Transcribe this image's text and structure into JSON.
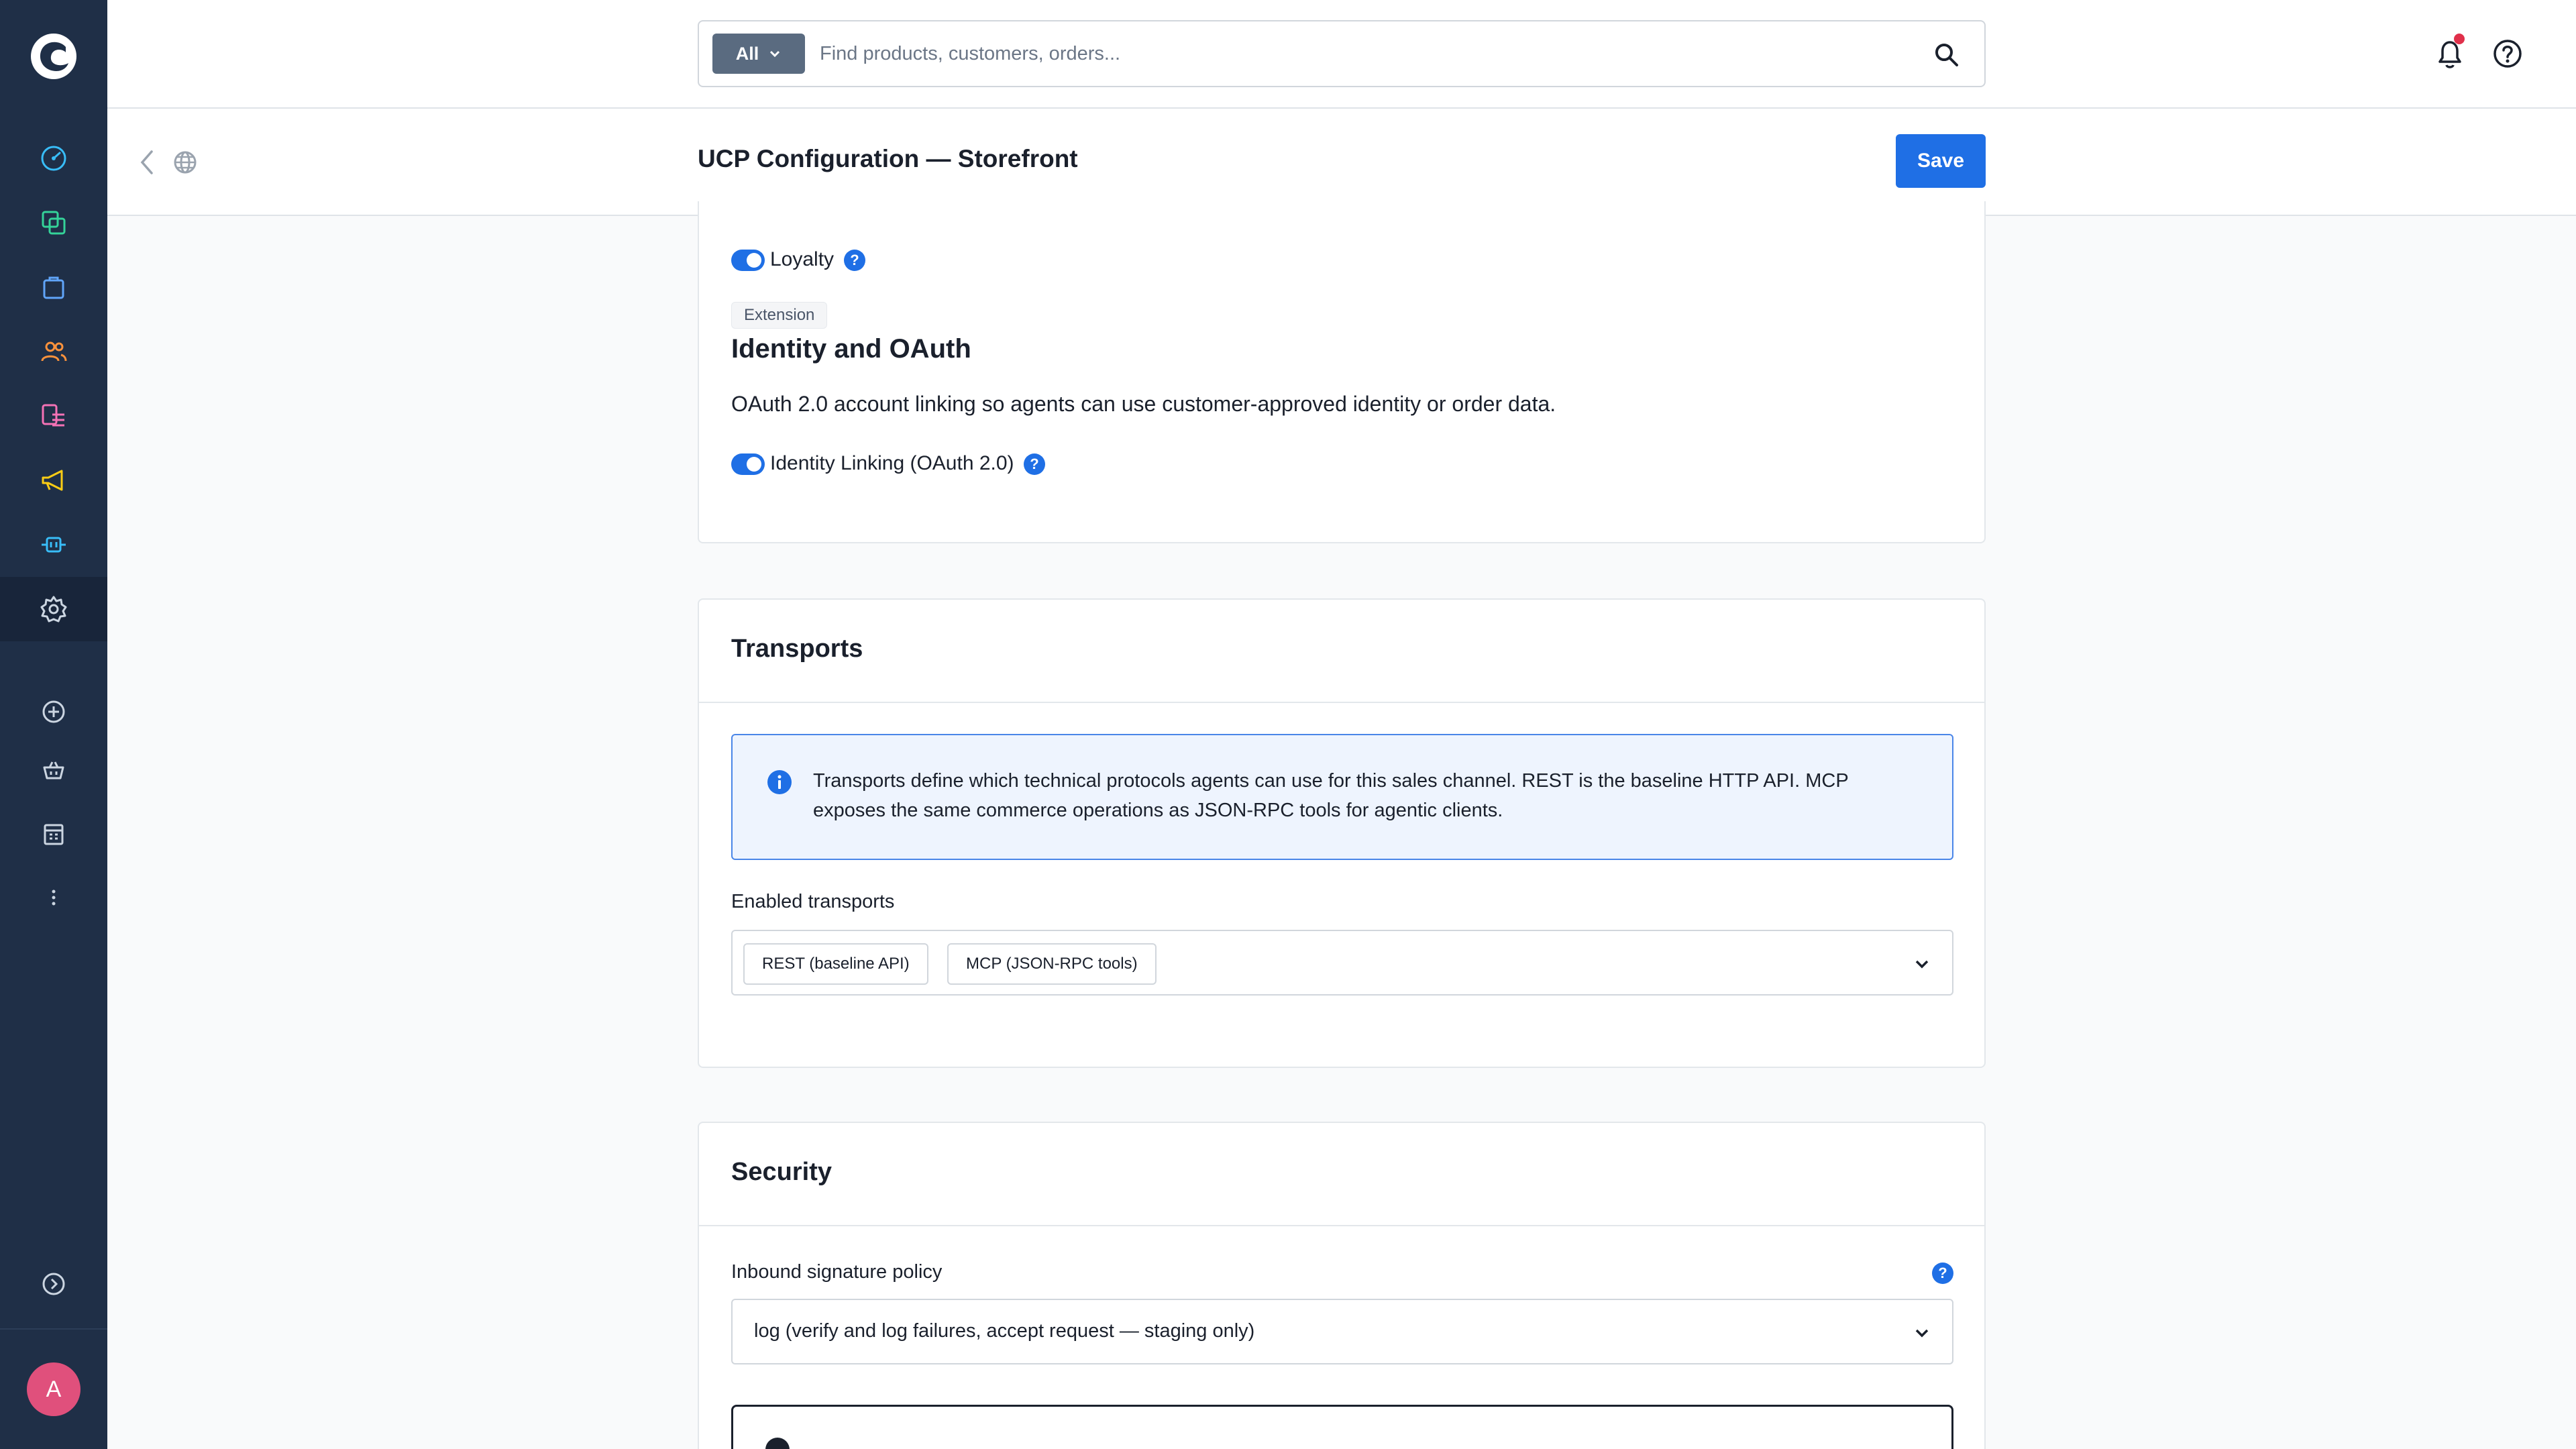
{
  "app": {
    "logo_icon": "shopware-logo-icon",
    "avatar_initial": "A"
  },
  "sidebar": {
    "items": [
      {
        "name": "dashboard",
        "icon": "gauge-icon",
        "color": "#38bdf8"
      },
      {
        "name": "catalogues",
        "icon": "copy-icon",
        "color": "#34d399"
      },
      {
        "name": "orders",
        "icon": "shopping-bag-icon",
        "color": "#60a5fa"
      },
      {
        "name": "customers",
        "icon": "users-icon",
        "color": "#fb923c"
      },
      {
        "name": "content",
        "icon": "content-list-icon",
        "color": "#f472b6"
      },
      {
        "name": "marketing",
        "icon": "megaphone-icon",
        "color": "#facc15"
      },
      {
        "name": "extensions",
        "icon": "plug-icon",
        "color": "#38bdf8"
      },
      {
        "name": "settings",
        "icon": "gear-icon",
        "color": "#cbd5e1",
        "active": true
      }
    ],
    "secondary": [
      {
        "name": "add-sales-channel",
        "icon": "plus-circle-icon"
      },
      {
        "name": "storefront",
        "icon": "basket-icon"
      },
      {
        "name": "headless",
        "icon": "store-icon"
      },
      {
        "name": "more",
        "icon": "more-vertical-icon"
      }
    ],
    "collapse_icon": "chevron-right-circle-icon"
  },
  "search": {
    "scope": "All",
    "placeholder": "Find products, customers, orders..."
  },
  "header": {
    "title": "UCP Configuration — Storefront",
    "save_label": "Save"
  },
  "capabilities": {
    "loyalty_label": "Loyalty",
    "loyalty_enabled": true,
    "extension_badge": "Extension",
    "identity_heading": "Identity and OAuth",
    "identity_description": "OAuth 2.0 account linking so agents can use customer-approved identity or order data.",
    "identity_linking_label": "Identity Linking (OAuth 2.0)",
    "identity_linking_enabled": true,
    "help_glyph": "?"
  },
  "transports": {
    "title": "Transports",
    "info_text": "Transports define which technical protocols agents can use for this sales channel. REST is the baseline HTTP API. MCP exposes the same commerce operations as JSON-RPC tools for agentic clients.",
    "enabled_label": "Enabled transports",
    "selected": [
      "REST (baseline API)",
      "MCP (JSON-RPC tools)"
    ]
  },
  "security": {
    "title": "Security",
    "policy_label": "Inbound signature policy",
    "policy_value": "log (verify and log failures, accept request — staging only)"
  },
  "colors": {
    "sidebar_bg": "#1f2f47",
    "accent": "#1f6fe5",
    "info_border": "#4a86e8",
    "info_bg": "#eef4fe",
    "notification_dot": "#e0304a",
    "avatar_bg": "#e0507c"
  }
}
